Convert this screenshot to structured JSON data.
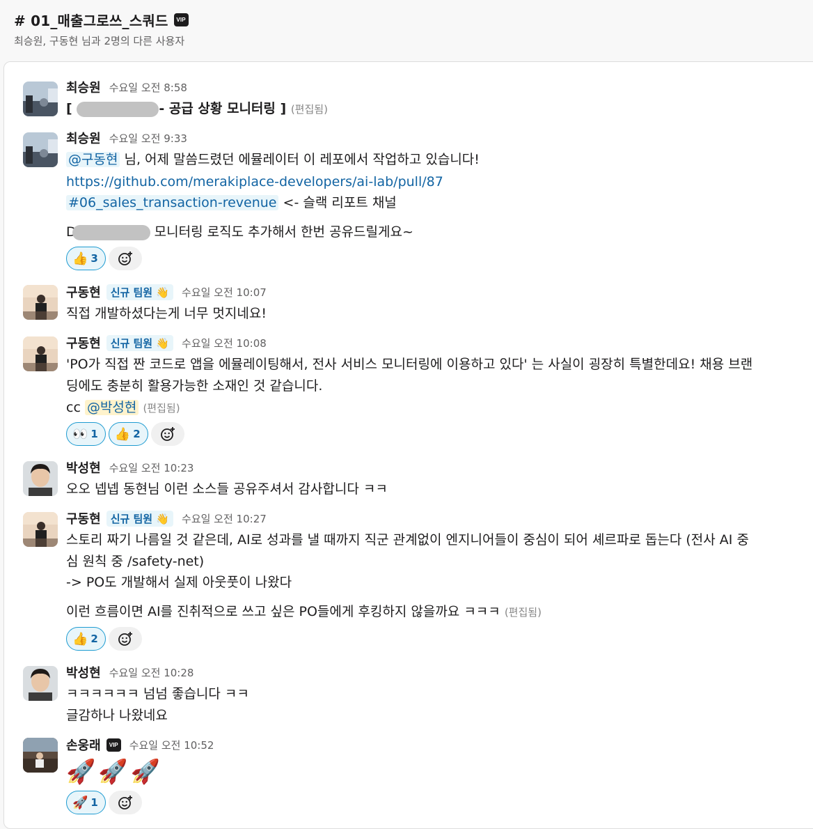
{
  "channel": {
    "title": "# 01_매출그로쓰_스쿼드",
    "vip": "VIP",
    "members": "최승원, 구동현 님과 2명의 다른 사용자"
  },
  "messages": [
    {
      "author": "최승원",
      "time": "수요일 오전 8:58",
      "lines": {
        "a_pre": "[",
        "a_post": "- 공급 상황 모니터링 ]",
        "edited": "(편집됨)"
      }
    },
    {
      "author": "최승원",
      "time": "수요일 오전 9:33",
      "mention": "@구동현",
      "line1": " 님, 어제 말씀드렸던 에뮬레이터 이 레포에서 작업하고 있습니다!",
      "link": "https://github.com/merakiplace-developers/ai-lab/pull/87",
      "channel_link": "#06_sales_transaction-revenue",
      "line3": " <- 슬랙 리포트 채널",
      "line4_pre": "D",
      "line4_post": "  모니터링 로직도 추가해서 한번 공유드릴게요~",
      "reactions": [
        {
          "emoji": "👍",
          "count": "3"
        }
      ]
    },
    {
      "author": "구동현",
      "tag": "신규 팀원 👋",
      "time": "수요일 오전 10:07",
      "text": "직접 개발하셨다는게 너무 멋지네요!"
    },
    {
      "author": "구동현",
      "tag": "신규 팀원 👋",
      "time": "수요일 오전 10:08",
      "line1": "'PO가 직접 짠 코드로 앱을 에뮬레이팅해서, 전사 서비스 모니터링에 이용하고 있다' 는 사실이 굉장히 특별한데요! 채용 브랜",
      "line2": "딩에도 충분히 활용가능한 소재인 것 같습니다.",
      "cc": "cc ",
      "mention": "@박성현",
      "edited": "(편집됨)",
      "reactions": [
        {
          "emoji": "👀",
          "count": "1"
        },
        {
          "emoji": "👍",
          "count": "2"
        }
      ]
    },
    {
      "author": "박성현",
      "time": "수요일 오전 10:23",
      "text": "오오 넵넵 동현님 이런 소스들 공유주셔서 감사합니다 ㅋㅋ"
    },
    {
      "author": "구동현",
      "tag": "신규 팀원 👋",
      "time": "수요일 오전 10:27",
      "line1": "스토리 짜기 나름일 것 같은데, AI로 성과를 낼 때까지 직군 관계없이 엔지니어들이 중심이 되어 셰르파로 돕는다 (전사 AI 중",
      "line2": "심 원칙 중 /safety-net)",
      "line3": "-> PO도 개발해서 실제 아웃풋이 나왔다",
      "line4": "이런 흐름이면 AI를 진취적으로 쓰고 싶은 PO들에게 후킹하지 않을까요 ㅋㅋㅋ ",
      "edited": "(편집됨)",
      "reactions": [
        {
          "emoji": "👍",
          "count": "2"
        }
      ]
    },
    {
      "author": "박성현",
      "time": "수요일 오전 10:28",
      "line1": "ㅋㅋㅋㅋㅋㅋ 넘넘 좋습니다 ㅋㅋ",
      "line2": "글감하나 나왔네요"
    },
    {
      "author": "손웅래",
      "vip": "VIP",
      "time": "수요일 오전 10:52",
      "text": "🚀🚀🚀",
      "reactions": [
        {
          "emoji": "🚀",
          "count": "1"
        }
      ]
    }
  ]
}
